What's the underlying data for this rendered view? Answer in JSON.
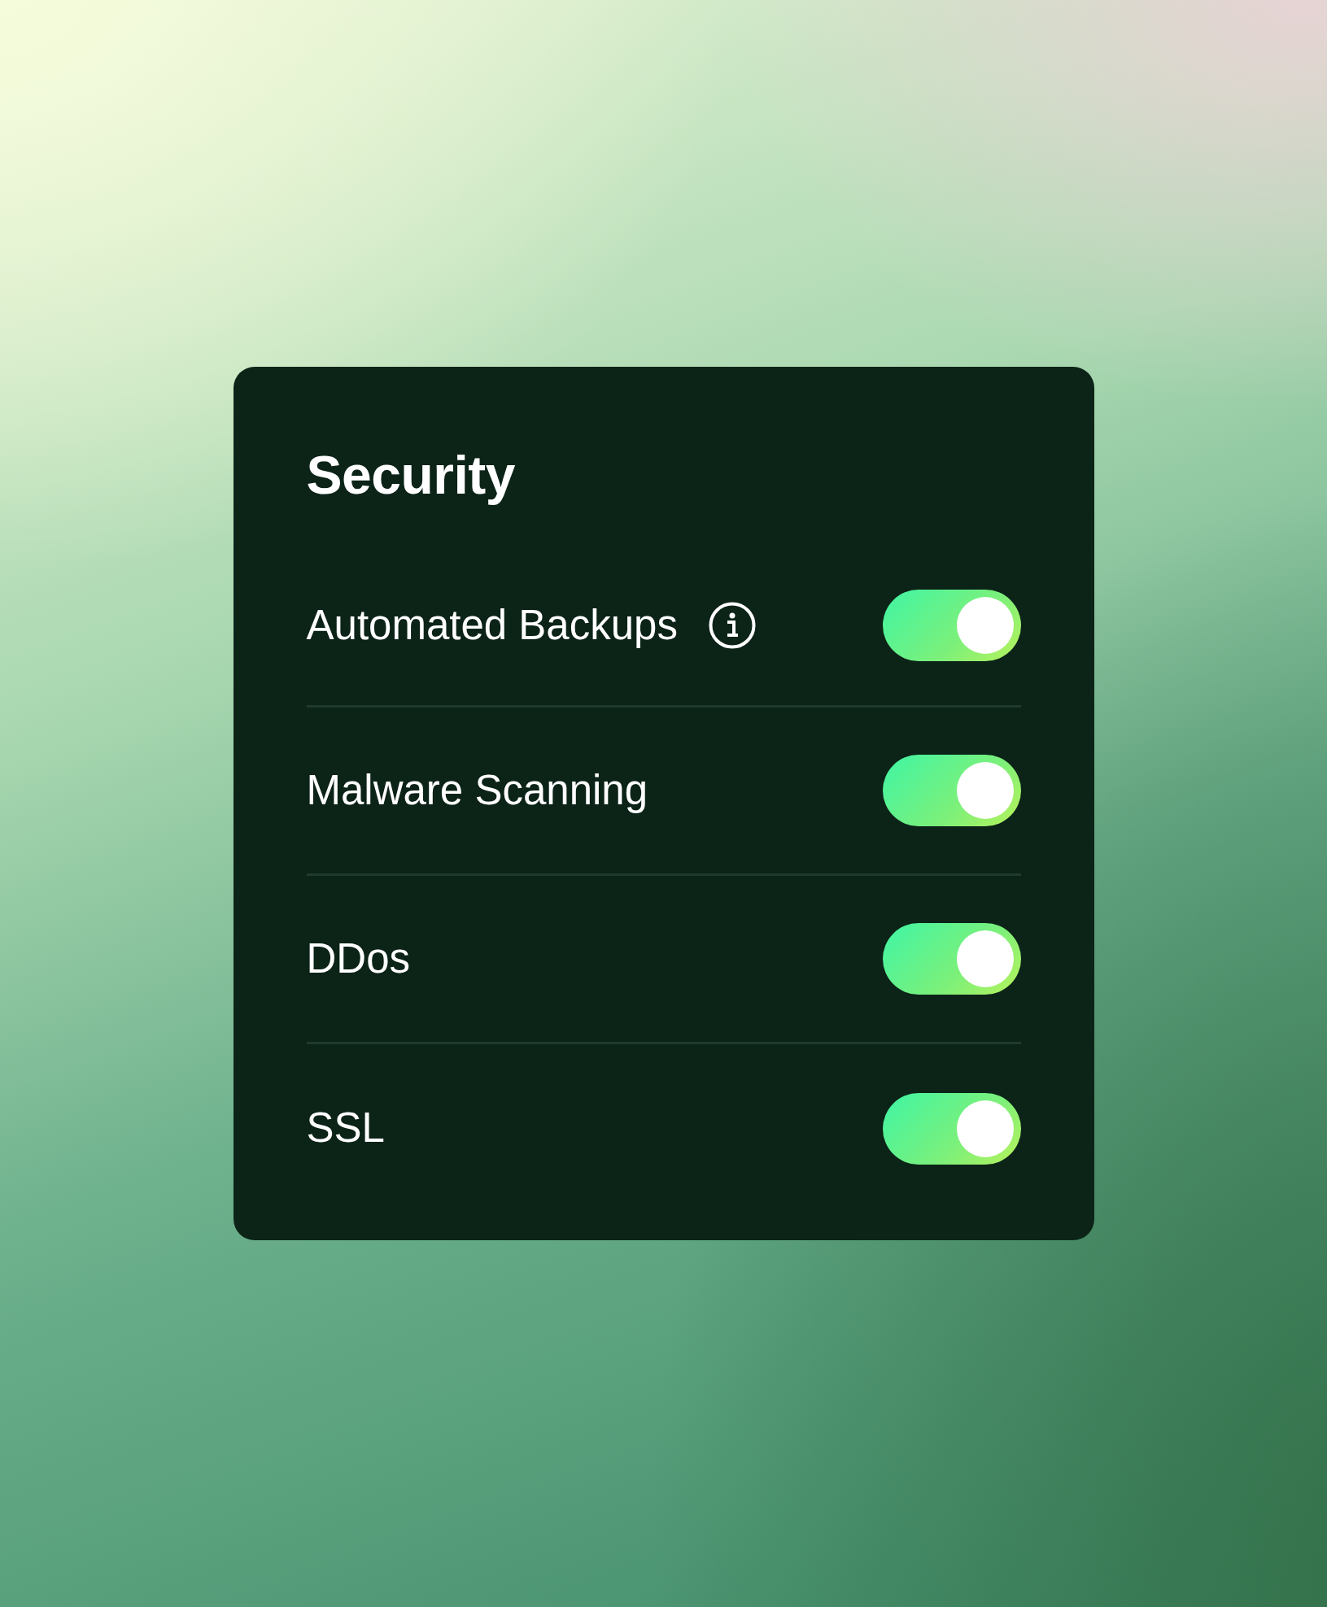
{
  "card": {
    "title": "Security",
    "settings": [
      {
        "label": "Automated Backups",
        "info": true,
        "checked": true
      },
      {
        "label": "Malware Scanning",
        "info": false,
        "checked": true
      },
      {
        "label": "DDos",
        "info": false,
        "checked": true
      },
      {
        "label": "SSL",
        "info": false,
        "checked": true
      }
    ]
  }
}
